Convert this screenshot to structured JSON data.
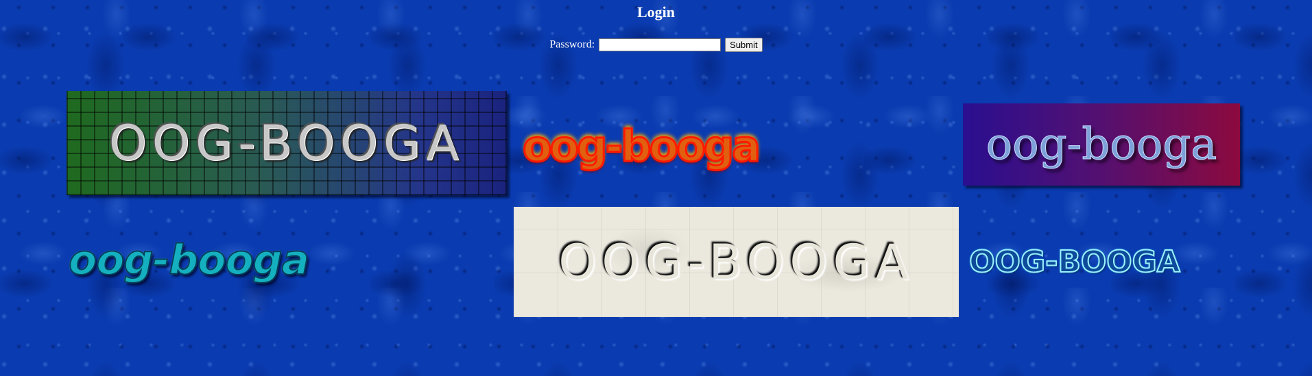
{
  "page": {
    "title": "Login"
  },
  "login": {
    "password_label": "Password:",
    "password_value": "",
    "submit_label": "Submit"
  },
  "logos": {
    "tile": "OOG-BOOGA",
    "fire": "oog-booga",
    "purple": "oog-booga",
    "cyan": "oog-booga",
    "marble": "OOG-BOOGA",
    "wavy": "OOG-BOOGA"
  },
  "colors": {
    "background": "#0a3bb0",
    "text": "#ffffff"
  }
}
